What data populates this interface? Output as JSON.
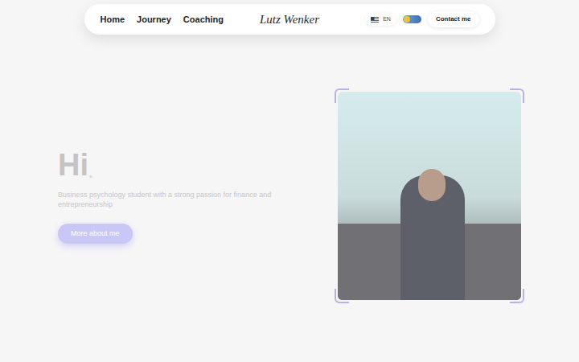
{
  "nav": {
    "links": [
      {
        "label": "Home",
        "selected": false
      },
      {
        "label": "Journey",
        "selected": false
      },
      {
        "label": "Coaching",
        "selected": false
      }
    ],
    "logo": "Lutz Wenker",
    "language": "EN",
    "theme_toggle": {
      "on": false
    },
    "contact": "Contact me"
  },
  "hero": {
    "greeting": "Hi",
    "greeting_dot": ".",
    "subtitle": "Business psychology student with a strong passion for finance and entrepreneurship",
    "button": "More about me"
  }
}
